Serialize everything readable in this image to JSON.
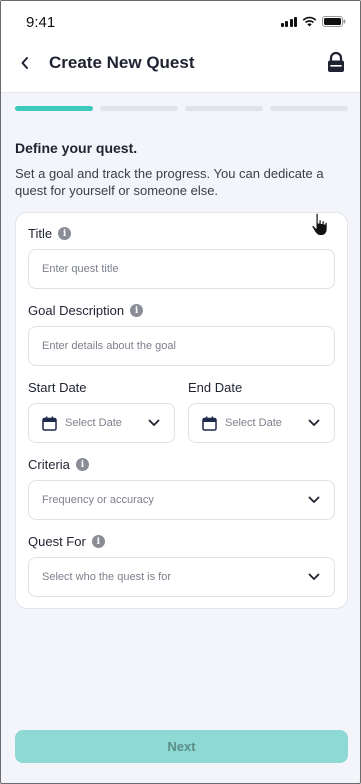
{
  "status_bar": {
    "time": "9:41",
    "icons": [
      "signal-icon",
      "wifi-icon",
      "battery-icon"
    ]
  },
  "header": {
    "title": "Create New Quest",
    "back_icon": "chevron-left-icon",
    "lock_icon": "lock-icon"
  },
  "stepper": {
    "total_steps": 4,
    "current_step": 1,
    "active_color": "#3ec9bd",
    "inactive_color": "#e1e3ec"
  },
  "intro": {
    "title": "Define your quest.",
    "description": "Set a goal and track the progress. You can dedicate a quest for yourself or someone else."
  },
  "form": {
    "title": {
      "label": "Title",
      "placeholder": "Enter quest title"
    },
    "goal": {
      "label": "Goal Description",
      "placeholder": "Enter details about the goal"
    },
    "start_date": {
      "label": "Start Date",
      "placeholder": "Select Date"
    },
    "end_date": {
      "label": "End Date",
      "placeholder": "Select Date"
    },
    "criteria": {
      "label": "Criteria",
      "placeholder": "Frequency or accuracy"
    },
    "quest_for": {
      "label": "Quest For",
      "placeholder": "Select who the quest is for"
    }
  },
  "footer": {
    "next_label": "Next",
    "next_color": "#8ed9d3"
  }
}
